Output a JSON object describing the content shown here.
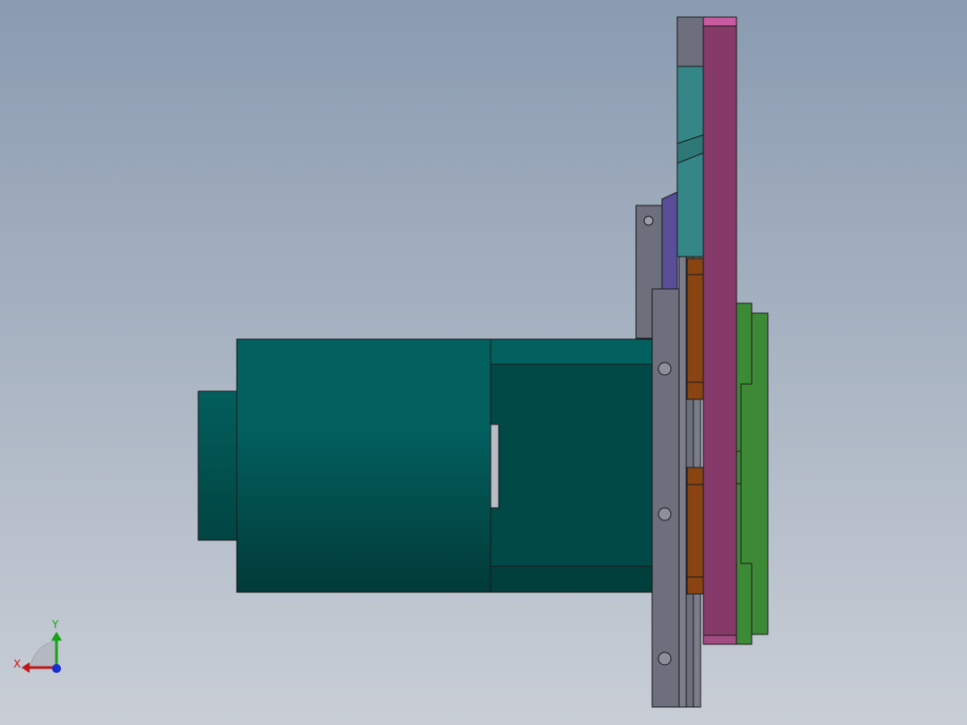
{
  "viewport": {
    "background_top": "#8a9bb0",
    "background_bottom": "#c9ced6"
  },
  "colors": {
    "motor_main": "#02605f",
    "motor_dark": "#013f3c",
    "flange": "#014946",
    "plate_gray": "#6d6f7d",
    "plate_gray_light": "#7b7d8a",
    "magenta_plate": "#863a6a",
    "magenta_top": "#c85aa0",
    "teal_block": "#348786",
    "purple_wedge": "#5a4d97",
    "orange_blocks": "#8a4412",
    "green_plates": "#3d8a36",
    "outline": "#1a1a1a"
  },
  "triad": {
    "x_label": "X",
    "y_label": "Y",
    "x_color": "#c0171b",
    "y_color": "#16a316",
    "z_color": "#1a2fd0"
  }
}
